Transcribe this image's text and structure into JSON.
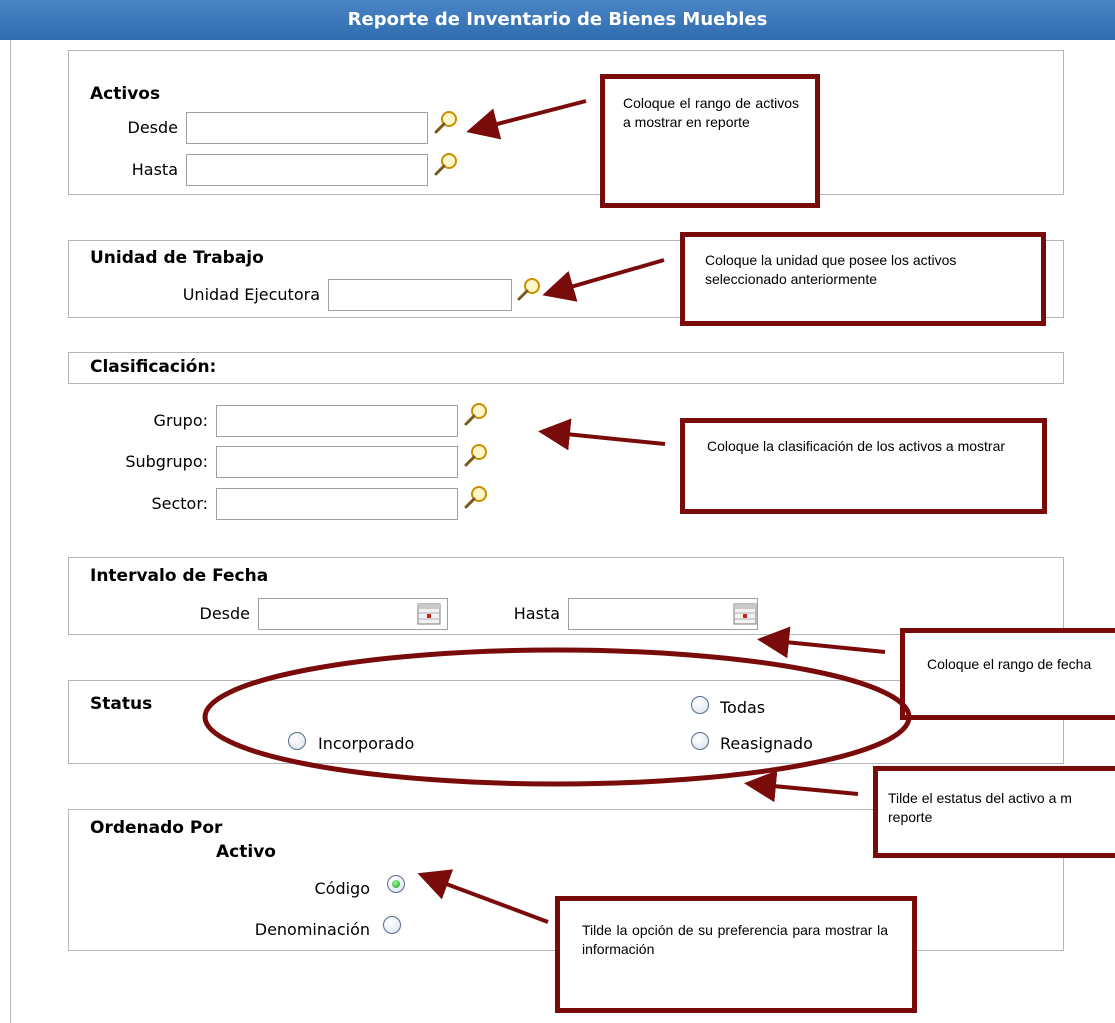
{
  "title": "Reporte de Inventario de Bienes Muebles",
  "activos": {
    "title": "Activos",
    "desde_label": "Desde",
    "hasta_label": "Hasta",
    "desde_value": "",
    "hasta_value": ""
  },
  "unidad": {
    "title": "Unidad de Trabajo",
    "label": "Unidad Ejecutora",
    "value": ""
  },
  "clasificacion": {
    "title": "Clasificación:",
    "grupo_label": "Grupo:",
    "subgrupo_label": "Subgrupo:",
    "sector_label": "Sector:"
  },
  "fecha": {
    "title": "Intervalo de Fecha",
    "desde_label": "Desde",
    "hasta_label": "Hasta"
  },
  "status": {
    "title": "Status",
    "options": [
      "Todas",
      "Incorporado",
      "Reasignado"
    ]
  },
  "orden": {
    "title": "Ordenado Por",
    "subtitle": "Activo",
    "options": [
      "Código",
      "Denominación"
    ],
    "selected": "Código"
  },
  "callouts": {
    "activos": "Coloque el rango de activos a mostrar en reporte",
    "unidad": "Coloque la unidad que posee los activos seleccionado anteriormente",
    "clasificacion": "Coloque la clasificación de los activos a mostrar",
    "fecha": "Coloque el rango de fecha",
    "status": "Tilde el estatus del activo a m\nreporte",
    "orden": "Tilde la opción de su preferencia para mostrar la información"
  },
  "colors": {
    "title_bar": "#2f6cae",
    "callout_border": "#7a0b0b",
    "radio_checked": "#1e9b1e"
  }
}
